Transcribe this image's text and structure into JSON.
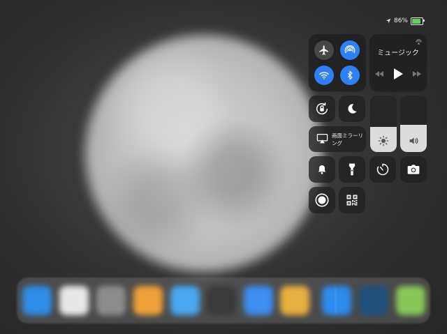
{
  "status_bar": {
    "battery_text": "86%",
    "battery_level": 0.86,
    "location_icon": "location-arrow-icon"
  },
  "control_center": {
    "connectivity": {
      "airplane_mode": {
        "icon": "airplane-icon",
        "active": false
      },
      "airdrop": {
        "icon": "airdrop-icon",
        "active": true
      },
      "wifi": {
        "icon": "wifi-icon",
        "active": true
      },
      "bluetooth": {
        "icon": "bluetooth-icon",
        "active": true
      }
    },
    "music": {
      "title": "ミュージック",
      "controls": [
        "rewind-icon",
        "play-icon",
        "fast-forward-icon"
      ],
      "airplay_icon": "airplay-audio-icon"
    },
    "orientation_lock": {
      "icon": "rotation-lock-icon"
    },
    "do_not_disturb": {
      "icon": "moon-icon"
    },
    "screen_mirroring": {
      "label": "画面ミラーリング",
      "icon": "screen-mirroring-icon"
    },
    "brightness": {
      "icon": "sun-icon",
      "level": 0.45
    },
    "volume": {
      "icon": "speaker-icon",
      "level": 0.48
    },
    "silent": {
      "icon": "bell-icon"
    },
    "flashlight": {
      "icon": "flashlight-icon"
    },
    "timer": {
      "icon": "timer-icon"
    },
    "camera": {
      "icon": "camera-icon"
    },
    "screen_recording": {
      "icon": "record-icon"
    },
    "qr_scanner": {
      "icon": "qr-code-icon"
    }
  },
  "dock": {
    "apps": [
      {
        "name": "safari-app",
        "color": "#2f8ee8"
      },
      {
        "name": "clock-app",
        "color": "#e8e8e8"
      },
      {
        "name": "settings-app",
        "color": "#8d8d8d"
      },
      {
        "name": "photos-app",
        "color": "#f0a13a"
      },
      {
        "name": "files-app",
        "color": "#4aa8f0"
      },
      {
        "name": "camera-app",
        "color": "#3a3a3a"
      },
      {
        "name": "mail-app",
        "color": "#3d8ff0"
      },
      {
        "name": "photos-app-2",
        "color": "#e8b040"
      },
      {
        "name": "app-store-app",
        "color": "#2d8cf0"
      },
      {
        "name": "clock-app-2",
        "color": "#1f4f7a"
      },
      {
        "name": "maps-app",
        "color": "#8ac75a"
      }
    ]
  },
  "colors": {
    "accent_blue": "#2f7ff5",
    "tile_bg": "#1e1e1e"
  }
}
